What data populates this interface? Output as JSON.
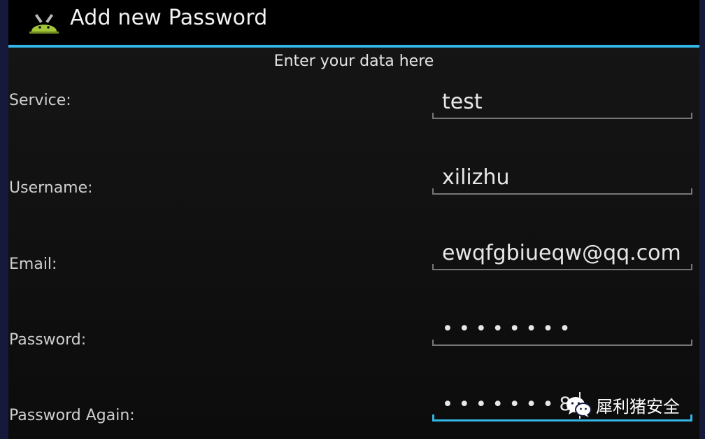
{
  "action_bar": {
    "title": "Add new Password",
    "app_icon": "android-icon",
    "accent_color": "#33b5e5"
  },
  "form": {
    "subtitle": "Enter your data here",
    "fields": [
      {
        "label": "Service:",
        "value": "test"
      },
      {
        "label": "Username:",
        "value": "xilizhu"
      },
      {
        "label": "Email:",
        "value": "ewqfgbiueqw@qq.com"
      },
      {
        "label": "Password:",
        "value": "••••••••"
      },
      {
        "label": "Password Again:",
        "value": "•••••••8"
      }
    ]
  },
  "watermark": {
    "icon": "wechat-icon",
    "text": "犀利猪安全"
  }
}
